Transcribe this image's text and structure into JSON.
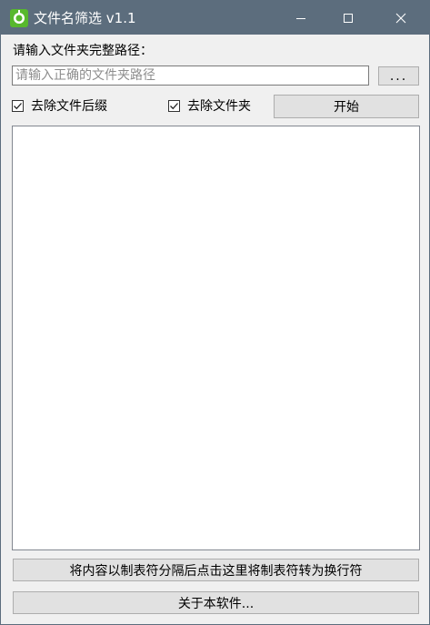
{
  "window": {
    "title": "文件名筛选 v1.1",
    "icon": "app-logo-icon",
    "controls": [
      "minimize-icon",
      "maximize-icon",
      "close-icon"
    ]
  },
  "path": {
    "label": "请输入文件夹完整路径：",
    "placeholder": "请输入正确的文件夹路径",
    "value": "",
    "browse_label": "..."
  },
  "options": {
    "remove_suffix_label": "去除文件后缀",
    "remove_suffix_checked": true,
    "remove_folder_label": "去除文件夹",
    "remove_folder_checked": true
  },
  "start_label": "开始",
  "output_text": "",
  "convert_label": "将内容以制表符分隔后点击这里将制表符转为换行符",
  "about_label": "关于本软件..."
}
